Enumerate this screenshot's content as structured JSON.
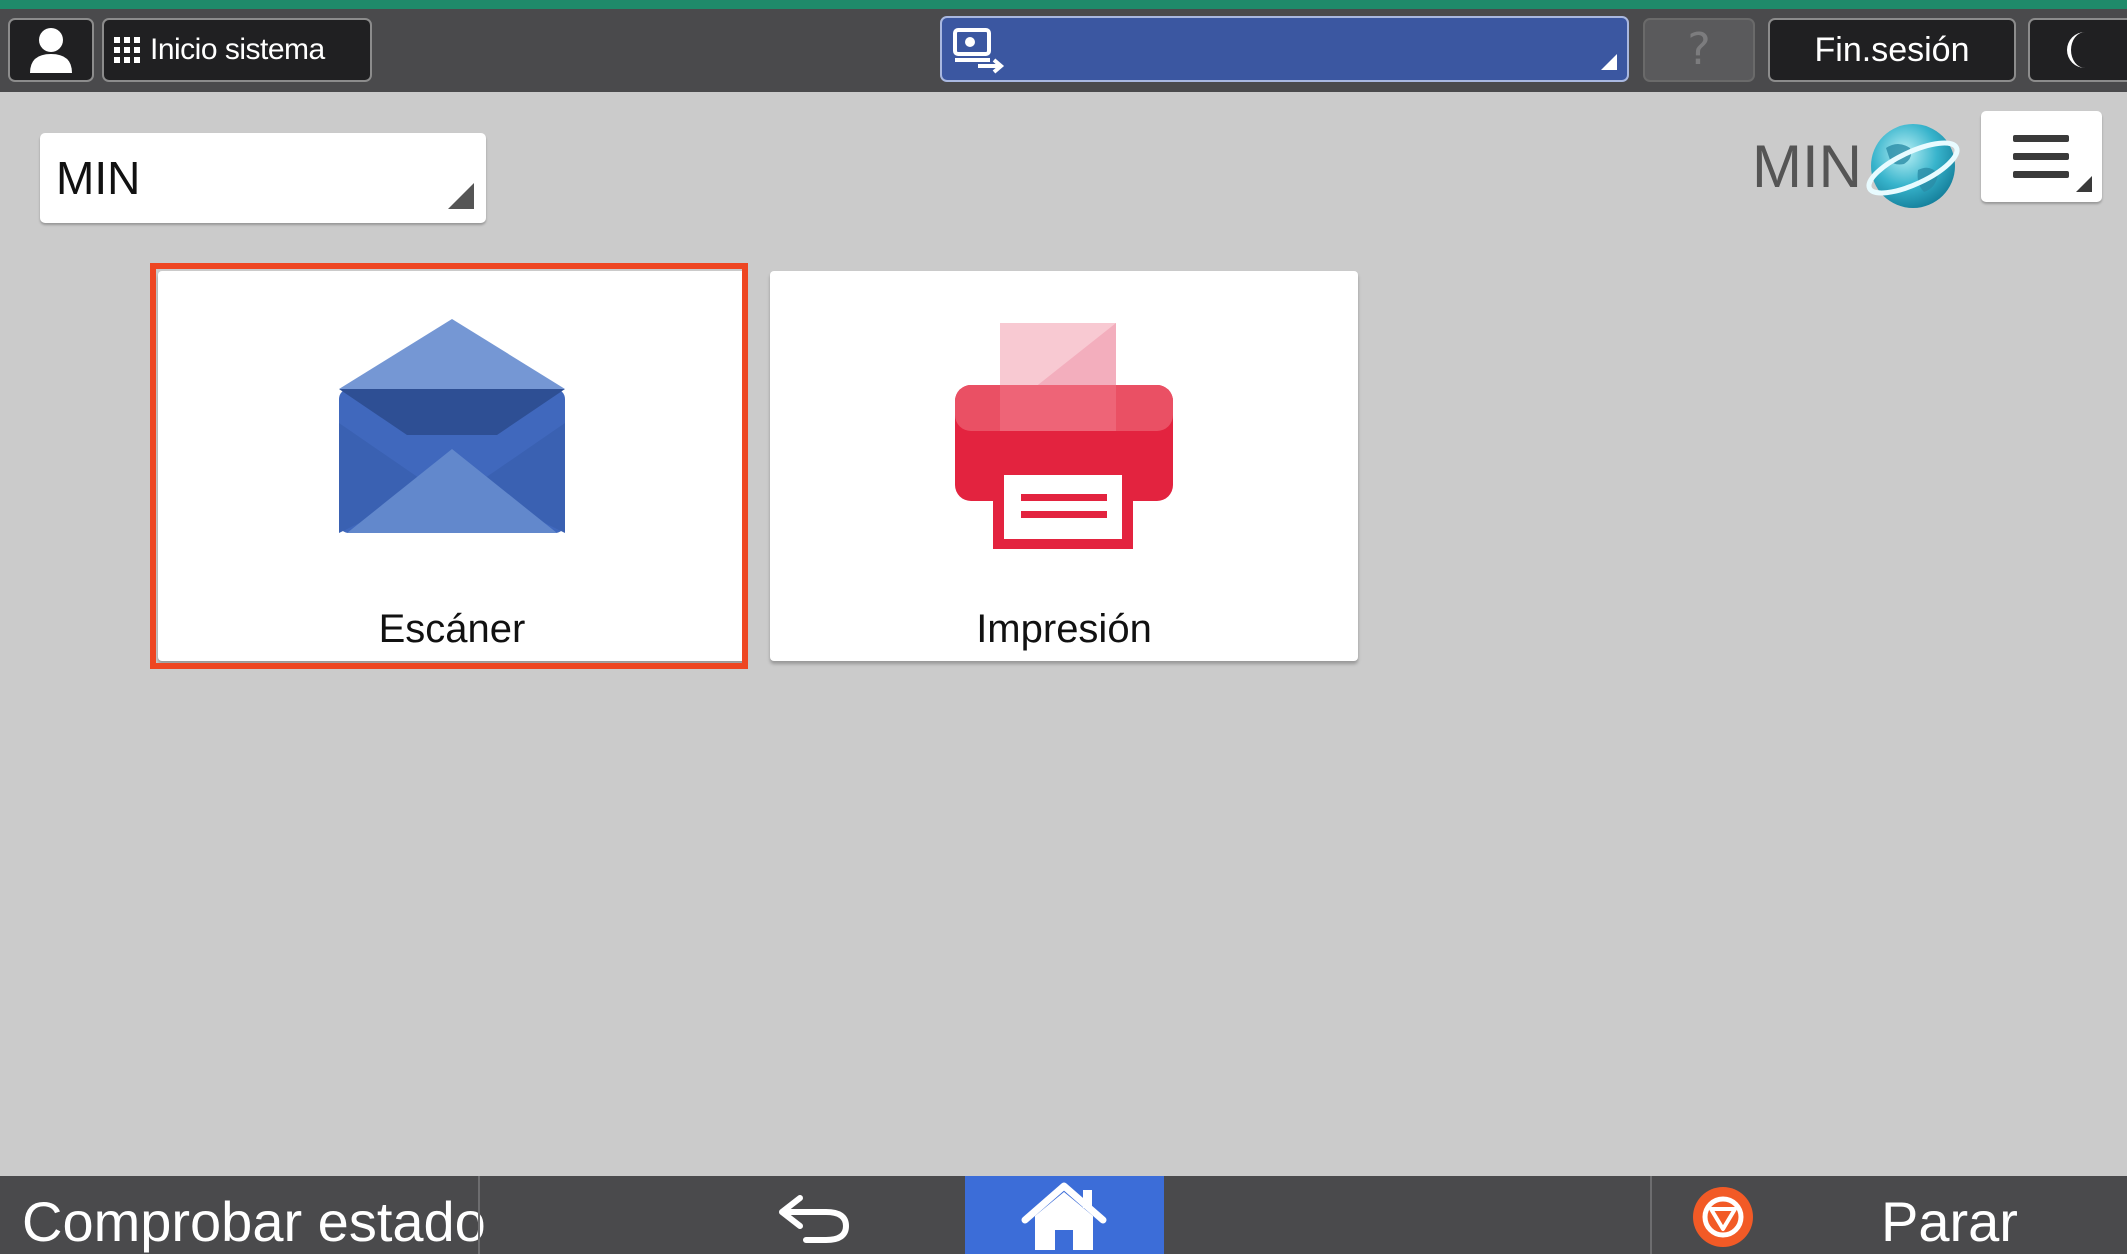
{
  "top_bar": {
    "system_home_label": "Inicio sistema",
    "help_label": "?",
    "logout_label": "Fin.sesión",
    "accent_color": "#1f8a6a"
  },
  "header": {
    "group_select_value": "MIN",
    "user_name": "MIN"
  },
  "apps": [
    {
      "label": "Escáner",
      "icon": "envelope-icon",
      "selected": true
    },
    {
      "label": "Impresión",
      "icon": "printer-icon",
      "selected": false
    }
  ],
  "bottom_bar": {
    "check_status_label": "Comprobar estado",
    "stop_label": "Parar",
    "home_color": "#3c6dd8"
  },
  "colors": {
    "selection": "#ee4622",
    "message_bar": "#3b57a1",
    "background": "#cbcbcb"
  }
}
